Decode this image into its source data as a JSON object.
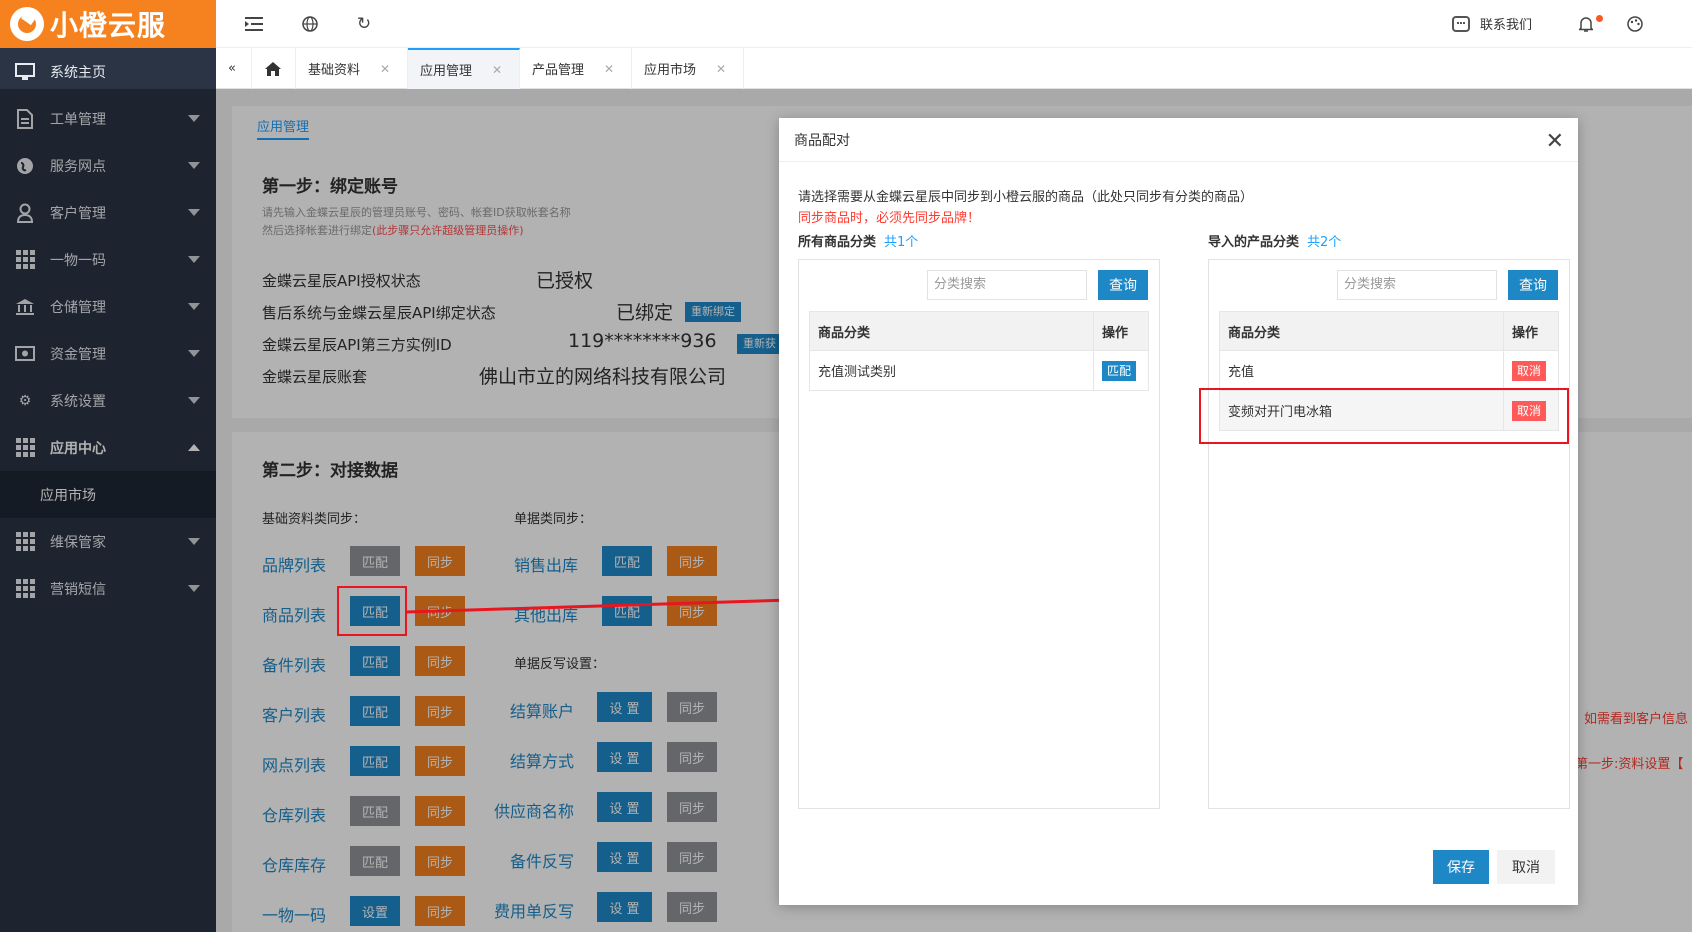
{
  "brand": {
    "name": "小橙云服"
  },
  "sidebar": {
    "items": [
      {
        "label": "系统主页",
        "icon": "monitor-icon"
      },
      {
        "label": "工单管理",
        "icon": "document-icon"
      },
      {
        "label": "服务网点",
        "icon": "globe-icon"
      },
      {
        "label": "客户管理",
        "icon": "user-icon"
      },
      {
        "label": "一物一码",
        "icon": "grid-icon"
      },
      {
        "label": "仓储管理",
        "icon": "bank-icon"
      },
      {
        "label": "资金管理",
        "icon": "money-icon"
      },
      {
        "label": "系统设置",
        "icon": "gear-icon"
      },
      {
        "label": "应用中心",
        "icon": "grid-icon"
      },
      {
        "label": "维保管家",
        "icon": "grid-icon"
      },
      {
        "label": "营销短信",
        "icon": "grid-icon"
      }
    ],
    "sub_active": "应用市场"
  },
  "topbar": {
    "contact": "联系我们"
  },
  "tabs": [
    {
      "label": "基础资料"
    },
    {
      "label": "应用管理"
    },
    {
      "label": "产品管理"
    },
    {
      "label": "应用市场"
    }
  ],
  "page": {
    "mini_tab": "应用管理",
    "step1": {
      "title": "第一步：绑定账号",
      "note1": "请先输入金蝶云星辰的管理员账号、密码、帐套ID获取帐套名称",
      "note2": "然后选择帐套进行绑定",
      "note2_red": "(此步骤只允许超级管理员操作)",
      "rows": [
        {
          "label": "金蝶云星辰API授权状态",
          "value": "已授权"
        },
        {
          "label": "售后系统与金蝶云星辰API绑定状态",
          "value": "已绑定",
          "tag": "重新绑定"
        },
        {
          "label": "金蝶云星辰API第三方实例ID",
          "value": "119********936",
          "tag": "重新获"
        },
        {
          "label": "金蝶云星辰账套",
          "value": "佛山市立的网络科技有限公司"
        }
      ]
    },
    "step2": {
      "title": "第二步：对接数据",
      "left_header": "基础资料类同步：",
      "right_header": "单据类同步：",
      "right_header2": "单据反写设置：",
      "left_rows": [
        {
          "label": "品牌列表",
          "b1": "匹配",
          "b2": "同步"
        },
        {
          "label": "商品列表",
          "b1": "匹配",
          "b2": "同步"
        },
        {
          "label": "备件列表",
          "b1": "匹配",
          "b2": "同步"
        },
        {
          "label": "客户列表",
          "b1": "匹配",
          "b2": "同步"
        },
        {
          "label": "网点列表",
          "b1": "匹配",
          "b2": "同步"
        },
        {
          "label": "仓库列表",
          "b1": "匹配",
          "b2": "同步"
        },
        {
          "label": "仓库库存",
          "b1": "匹配",
          "b2": "同步"
        },
        {
          "label": "一物一码",
          "b1": "设置",
          "b2": "同步"
        }
      ],
      "right_rows": [
        {
          "label": "销售出库",
          "b1": "匹配",
          "b2": "同步"
        },
        {
          "label": "其他出库",
          "b1": "匹配",
          "b2": "同步"
        },
        {
          "label": "结算账户",
          "b1": "设 置",
          "b2": "同步"
        },
        {
          "label": "结算方式",
          "b1": "设 置",
          "b2": "同步"
        },
        {
          "label": "供应商名称",
          "b1": "设 置",
          "b2": "同步"
        },
        {
          "label": "备件反写",
          "b1": "设 置",
          "b2": "同步"
        },
        {
          "label": "费用单反写",
          "b1": "设 置",
          "b2": "同步"
        }
      ],
      "side_note1": "如需看到客户信息",
      "side_note2": "第一步:资料设置【"
    }
  },
  "modal": {
    "title": "商品配对",
    "desc": "请选择需要从金蝶云星辰中同步到小橙云服的商品（此处只同步有分类的商品）",
    "warn": "同步商品时，必须先同步品牌！",
    "left": {
      "title": "所有商品分类",
      "count": "共1个",
      "search_placeholder": "分类搜索",
      "query": "查询",
      "col1": "商品分类",
      "col2": "操作",
      "rows": [
        {
          "name": "充值测试类别",
          "action": "匹配"
        }
      ]
    },
    "right": {
      "title": "导入的产品分类",
      "count": "共2个",
      "search_placeholder": "分类搜索",
      "query": "查询",
      "col1": "商品分类",
      "col2": "操作",
      "rows": [
        {
          "name": "充值",
          "action": "取消"
        },
        {
          "name": "变频对开门电冰箱",
          "action": "取消"
        }
      ]
    },
    "save": "保存",
    "cancel": "取消"
  },
  "colors": {
    "brand": "#f5821f",
    "sidebar": "#2b3444",
    "primary": "#1e88c7",
    "danger": "#ff5a5a",
    "highlight": "#e8161f"
  }
}
